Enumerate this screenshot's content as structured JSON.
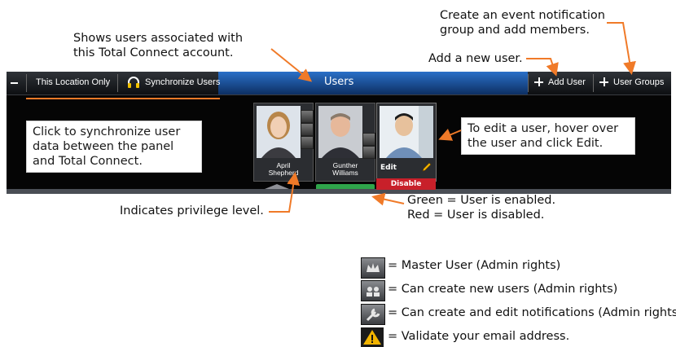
{
  "annotations": {
    "shows_users": "Shows users associated with\nthis Total Connect account.",
    "create_group": "Create an event notification\ngroup and add members.",
    "add_new_user": "Add a new user.",
    "sync_info": "Click to synchronize user\ndata between the panel\nand Total Connect.",
    "edit_info": "To edit a user, hover over\nthe user and click Edit.",
    "privilege": "Indicates privilege level.",
    "status_green": "Green = User is enabled.",
    "status_red": "Red = User is disabled."
  },
  "toolbar": {
    "location_filter": "This Location Only",
    "sync_label": "Synchronize Users",
    "title": "Users",
    "add_user": "Add User",
    "user_groups": "User Groups"
  },
  "users": [
    {
      "first": "April",
      "last": "Shepherd",
      "status": "enabled"
    },
    {
      "first": "Gunther",
      "last": "Williams",
      "status": "enabled"
    },
    {
      "first": "",
      "last": "",
      "status": "disabled",
      "edit_label": "Edit",
      "disable_label": "Disable"
    }
  ],
  "legend": [
    {
      "icon": "crown-icon",
      "text": "= Master User (Admin rights)"
    },
    {
      "icon": "users-icon",
      "text": "= Can create new users (Admin rights)"
    },
    {
      "icon": "wrench-icon",
      "text": "= Can create and edit notifications (Admin rights)"
    },
    {
      "icon": "warning-icon",
      "text": "= Validate your email address."
    }
  ],
  "colors": {
    "accent_orange": "#f07a28",
    "toolbar_blue": "#1f5fb4",
    "enabled_green": "#2fa54a",
    "disabled_red": "#c8202a"
  }
}
